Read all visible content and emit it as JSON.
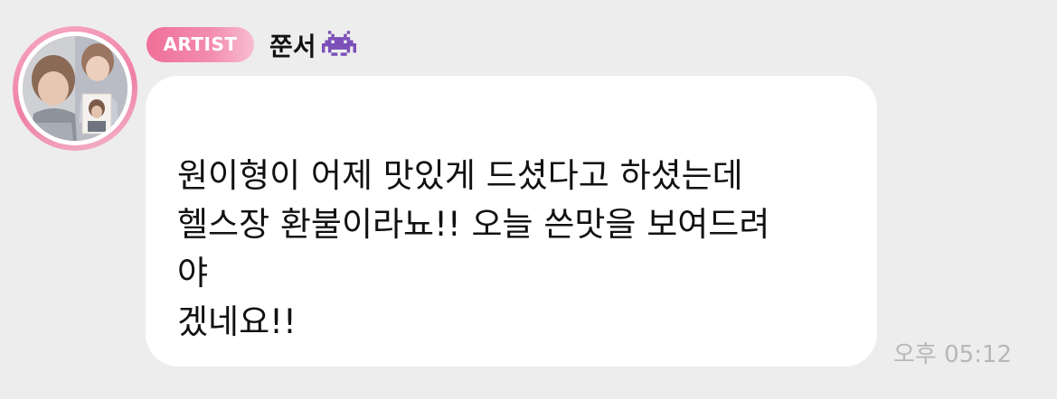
{
  "sender": {
    "badge": "ARTIST",
    "name": "쭌서",
    "emoji": "👾",
    "emoji_icon": "alien-monster-icon"
  },
  "message": {
    "lines": [
      "원이형이 어제 맛있게 드셨다고 하셨는데",
      "헬스장 환불이라뇨!! 오늘 쓴맛을 보여드려",
      "야",
      "겠네요!!"
    ],
    "timestamp": "오후 05:12"
  },
  "colors": {
    "background": "#ededed",
    "bubble": "#ffffff",
    "badge_start": "#ef6f98",
    "badge_end": "#f8bdd1",
    "avatar_ring": "#ef7fa6",
    "timestamp": "#b7b7b7"
  }
}
